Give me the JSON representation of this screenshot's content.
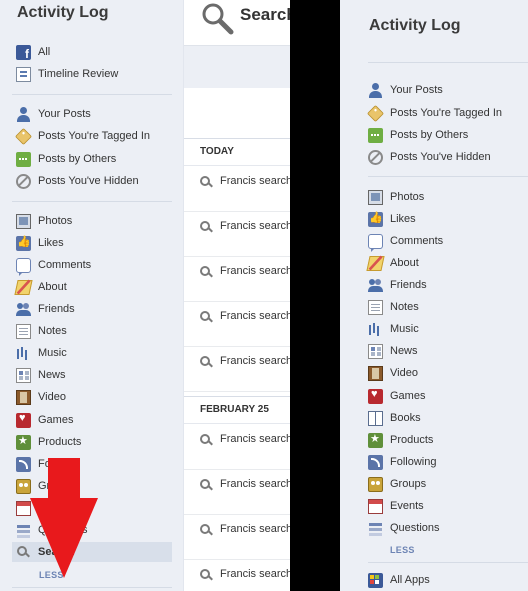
{
  "left_panel": {
    "title": "Activity Log",
    "top_items": [
      {
        "label": "All",
        "icon": "facebook-icon"
      },
      {
        "label": "Timeline Review",
        "icon": "timeline-icon"
      }
    ],
    "post_items": [
      {
        "label": "Your Posts",
        "icon": "person-icon"
      },
      {
        "label": "Posts You're Tagged In",
        "icon": "tag-icon"
      },
      {
        "label": "Posts by Others",
        "icon": "posts-icon"
      },
      {
        "label": "Posts You've Hidden",
        "icon": "hidden-icon"
      }
    ],
    "category_items": [
      {
        "label": "Photos",
        "icon": "photos-icon"
      },
      {
        "label": "Likes",
        "icon": "likes-icon"
      },
      {
        "label": "Comments",
        "icon": "comments-icon"
      },
      {
        "label": "About",
        "icon": "about-icon"
      },
      {
        "label": "Friends",
        "icon": "friends-icon"
      },
      {
        "label": "Notes",
        "icon": "notes-icon"
      },
      {
        "label": "Music",
        "icon": "music-icon"
      },
      {
        "label": "News",
        "icon": "news-icon"
      },
      {
        "label": "Video",
        "icon": "video-icon"
      },
      {
        "label": "Games",
        "icon": "games-icon"
      },
      {
        "label": "Products",
        "icon": "products-icon"
      },
      {
        "label": "Fol",
        "icon": "following-icon"
      },
      {
        "label": "Gro",
        "icon": "groups-icon"
      },
      {
        "label": "Ev",
        "icon": "events-icon"
      },
      {
        "label": "Questions",
        "icon": "questions-icon"
      }
    ],
    "selected_item": {
      "label": "Search",
      "icon": "search-icon"
    },
    "less_label": "LESS"
  },
  "middle_panel": {
    "title": "Search",
    "sections": [
      {
        "heading": "TODAY",
        "rows": [
          "Francis search",
          "Francis search",
          "Francis search",
          "Francis search",
          "Francis search"
        ]
      },
      {
        "heading": "FEBRUARY 25",
        "rows": [
          "Francis search",
          "Francis search",
          "Francis search",
          "Francis search"
        ]
      }
    ]
  },
  "right_panel": {
    "title": "Activity Log",
    "post_items": [
      {
        "label": "Your Posts",
        "icon": "person-icon"
      },
      {
        "label": "Posts You're Tagged In",
        "icon": "tag-icon"
      },
      {
        "label": "Posts by Others",
        "icon": "posts-icon"
      },
      {
        "label": "Posts You've Hidden",
        "icon": "hidden-icon"
      }
    ],
    "category_items": [
      {
        "label": "Photos",
        "icon": "photos-icon"
      },
      {
        "label": "Likes",
        "icon": "likes-icon"
      },
      {
        "label": "Comments",
        "icon": "comments-icon"
      },
      {
        "label": "About",
        "icon": "about-icon"
      },
      {
        "label": "Friends",
        "icon": "friends-icon"
      },
      {
        "label": "Notes",
        "icon": "notes-icon"
      },
      {
        "label": "Music",
        "icon": "music-icon"
      },
      {
        "label": "News",
        "icon": "news-icon"
      },
      {
        "label": "Video",
        "icon": "video-icon"
      },
      {
        "label": "Games",
        "icon": "games-icon"
      },
      {
        "label": "Books",
        "icon": "books-icon"
      },
      {
        "label": "Products",
        "icon": "products-icon"
      },
      {
        "label": "Following",
        "icon": "following-icon"
      },
      {
        "label": "Groups",
        "icon": "groups-icon"
      },
      {
        "label": "Events",
        "icon": "events-icon"
      },
      {
        "label": "Questions",
        "icon": "questions-icon"
      }
    ],
    "less_label": "LESS",
    "apps_item": {
      "label": "All Apps",
      "icon": "apps-icon"
    }
  },
  "colors": {
    "sidebar_bg": "#eceff5",
    "selected_bg": "#d8dfea",
    "less_link": "#6d84b4",
    "annotation_arrow": "#e8191c",
    "gap": "#000000"
  }
}
